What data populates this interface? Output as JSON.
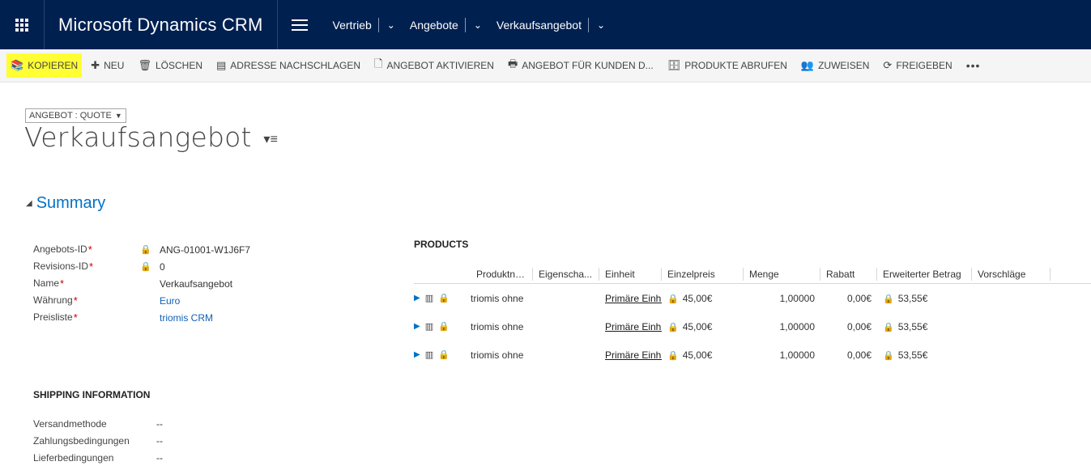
{
  "app": {
    "title": "Microsoft Dynamics CRM"
  },
  "nav": {
    "breadcrumbs": [
      {
        "label": "Vertrieb"
      },
      {
        "label": "Angebote"
      },
      {
        "label": "Verkaufsangebot"
      }
    ]
  },
  "commands": [
    {
      "label": "KOPIEREN",
      "icon": "copy-icon",
      "glyph": "📚"
    },
    {
      "label": "NEU",
      "icon": "plus-icon",
      "glyph": "✚"
    },
    {
      "label": "LÖSCHEN",
      "icon": "trash-icon",
      "glyph": "🗑"
    },
    {
      "label": "ADRESSE NACHSCHLAGEN",
      "icon": "address-book-icon",
      "glyph": "▤"
    },
    {
      "label": "ANGEBOT AKTIVIEREN",
      "icon": "activate-icon",
      "glyph": "🗋"
    },
    {
      "label": "ANGEBOT FÜR KUNDEN D...",
      "icon": "print-icon",
      "glyph": "🖶"
    },
    {
      "label": "PRODUKTE ABRUFEN",
      "icon": "get-products-icon",
      "glyph": "🗄"
    },
    {
      "label": "ZUWEISEN",
      "icon": "assign-icon",
      "glyph": "👥"
    },
    {
      "label": "FREIGEBEN",
      "icon": "share-icon",
      "glyph": "⟳"
    }
  ],
  "more_glyph": "•••",
  "highlight_color": "#ffff33",
  "header": {
    "entity_switch": "ANGEBOT : QUOTE",
    "title": "Verkaufsangebot"
  },
  "summary": {
    "heading": "Summary",
    "fields": [
      {
        "label": "Angebots-ID",
        "locked": true,
        "value": "ANG-01001-W1J6F7"
      },
      {
        "label": "Revisions-ID",
        "locked": true,
        "value": "0"
      },
      {
        "label": "Name",
        "locked": false,
        "value": "Verkaufsangebot"
      },
      {
        "label": "Währung",
        "locked": false,
        "value": "Euro"
      },
      {
        "label": "Preisliste",
        "locked": false,
        "value": "triomis CRM"
      }
    ]
  },
  "products": {
    "heading": "PRODUCTS",
    "columns": [
      "Produktname",
      "Eigenscha...",
      "Einheit",
      "Einzelpreis",
      "Menge",
      "Rabatt",
      "Erweiterter Betrag",
      "Vorschläge"
    ],
    "rows": [
      {
        "produktname": "triomis ohne",
        "einheit": "Primäre Einh...",
        "einzelpreis": "45,00€",
        "menge": "1,00000",
        "rabatt": "0,00€",
        "erweitert": "53,55€"
      },
      {
        "produktname": "triomis ohne",
        "einheit": "Primäre Einh...",
        "einzelpreis": "45,00€",
        "menge": "1,00000",
        "rabatt": "0,00€",
        "erweitert": "53,55€"
      },
      {
        "produktname": "triomis ohne",
        "einheit": "Primäre Einh...",
        "einzelpreis": "45,00€",
        "menge": "1,00000",
        "rabatt": "0,00€",
        "erweitert": "53,55€"
      }
    ]
  },
  "shipping": {
    "heading": "SHIPPING INFORMATION",
    "fields": [
      {
        "label": "Versandmethode",
        "value": "--"
      },
      {
        "label": "Zahlungsbedingungen",
        "value": "--"
      },
      {
        "label": "Lieferbedingungen",
        "value": "--"
      }
    ]
  }
}
